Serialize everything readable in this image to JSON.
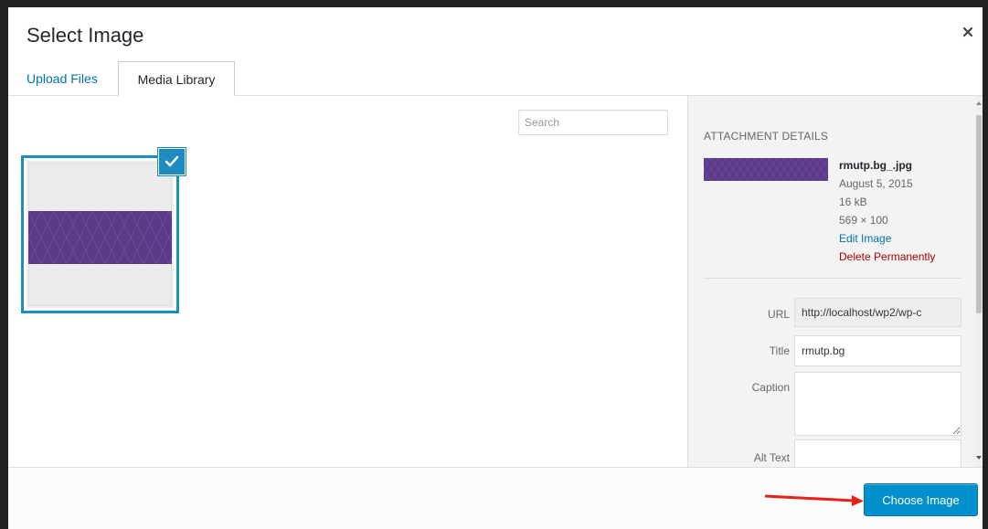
{
  "modal": {
    "title": "Select Image",
    "close_icon": "close-icon",
    "tabs": [
      {
        "label": "Upload Files",
        "active": false
      },
      {
        "label": "Media Library",
        "active": true
      }
    ]
  },
  "library": {
    "search_placeholder": "Search",
    "attachments": [
      {
        "selected": true,
        "thumbnail_color": "#5b3a8a",
        "check_icon": "checkmark-icon"
      }
    ]
  },
  "details": {
    "heading": "ATTACHMENT DETAILS",
    "filename": "rmutp.bg_.jpg",
    "date": "August 5, 2015",
    "size": "16 kB",
    "dimensions": "569 × 100",
    "edit_label": "Edit Image",
    "delete_label": "Delete Permanently",
    "fields": {
      "url": {
        "label": "URL",
        "value": "http://localhost/wp2/wp-c"
      },
      "title": {
        "label": "Title",
        "value": "rmutp.bg"
      },
      "caption": {
        "label": "Caption",
        "value": ""
      },
      "alt": {
        "label": "Alt Text",
        "value": ""
      }
    }
  },
  "toolbar": {
    "choose_label": "Choose Image",
    "annotation_arrow_color": "#e8201a"
  },
  "colors": {
    "accent": "#0091cd",
    "selection_border": "#1e8cbe",
    "link": "#0073aa",
    "delete": "#aa0000",
    "thumbnail_purple": "#5b3a8a"
  }
}
